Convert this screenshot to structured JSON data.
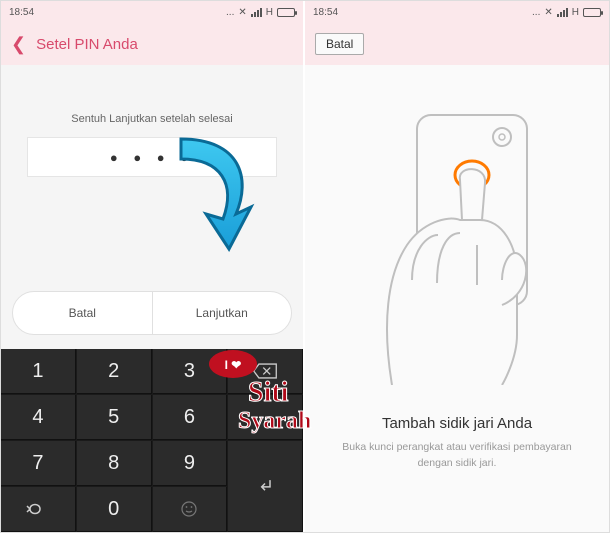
{
  "status": {
    "time": "18:54",
    "net1": "...",
    "sig_label": "signal",
    "net_type": "H",
    "batt": "battery"
  },
  "left": {
    "title": "Setel PIN Anda",
    "instruction": "Sentuh Lanjutkan setelah selesai",
    "pin_mask": "● ● ● ●",
    "cancel": "Batal",
    "continue": "Lanjutkan"
  },
  "keypad": {
    "k1": "1",
    "k2": "2",
    "k3": "3",
    "k4": "4",
    "k5": "5",
    "k6": "6",
    "k7": "7",
    "k8": "8",
    "k9": "9",
    "k0": "0",
    "backspace": "backspace",
    "period": ".",
    "enter": "enter",
    "back": "back",
    "smile": "smile"
  },
  "watermark": {
    "t1": "I ❤",
    "t2": "Siti",
    "t3": "Syarah"
  },
  "right": {
    "batal": "Batal",
    "title": "Tambah sidik jari Anda",
    "sub": "Buka kunci perangkat atau verifikasi pembayaran dengan sidik jari."
  }
}
